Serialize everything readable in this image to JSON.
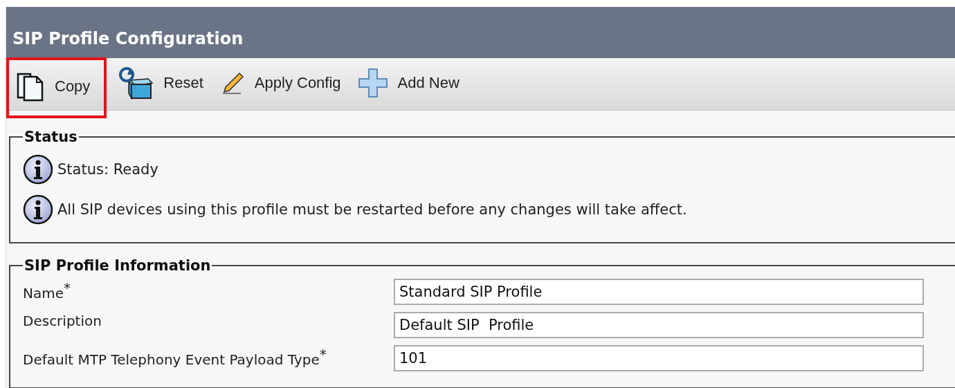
{
  "header": {
    "title": "SIP Profile Configuration"
  },
  "toolbar": [
    {
      "kind": "copy",
      "label": "Copy",
      "highlighted": true
    },
    {
      "kind": "reset",
      "label": "Reset",
      "highlighted": false
    },
    {
      "kind": "apply",
      "label": "Apply Config",
      "highlighted": false
    },
    {
      "kind": "add",
      "label": "Add New",
      "highlighted": false
    }
  ],
  "status": {
    "legend": "Status",
    "messages": [
      "Status: Ready",
      "All SIP devices using this profile must be restarted before any changes will take affect."
    ]
  },
  "info": {
    "legend": "SIP Profile Information",
    "fields": [
      {
        "label": "Name",
        "mark": "*",
        "value": "Standard SIP Profile"
      },
      {
        "label": "Description",
        "value": "Default SIP  Profile"
      },
      {
        "label": "Default MTP Telephony Event Payload Type",
        "mark": "*",
        "value": "101"
      }
    ]
  }
}
